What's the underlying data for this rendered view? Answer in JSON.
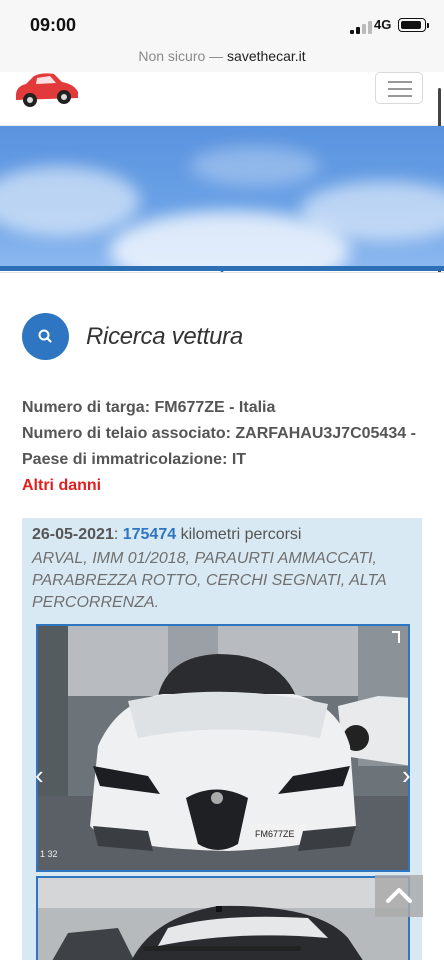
{
  "status_bar": {
    "time": "09:00",
    "network": "4G"
  },
  "browser": {
    "security_label": "Non sicuro —",
    "domain": "savethecar.it"
  },
  "header": {
    "logo_icon": "red-car-logo",
    "menu_icon": "hamburger-icon"
  },
  "search": {
    "icon": "search-icon",
    "title": "Ricerca vettura"
  },
  "vehicle": {
    "plate_line": "Numero di targa: FM677ZE - Italia",
    "vin_line": "Numero di telaio associato: ZARFAHAU3J7C05434 -",
    "country_line": "Paese di immatricolazione: IT",
    "other_damages_link": "Altri danni"
  },
  "entry": {
    "date": "26-05-2021",
    "separator": ": ",
    "km": "175474",
    "km_label": " kilometri percorsi",
    "description": "ARVAL, IMM 01/2018, PARAURTI AMMACCATI, PARABREZZA ROTTO, CERCHI SEGNATI, ALTA PERCORRENZA.",
    "photo_counter": "1 32"
  },
  "colors": {
    "accent_blue": "#2e76c1",
    "entry_bg": "#d9e9f3",
    "link_red": "#e02020"
  }
}
